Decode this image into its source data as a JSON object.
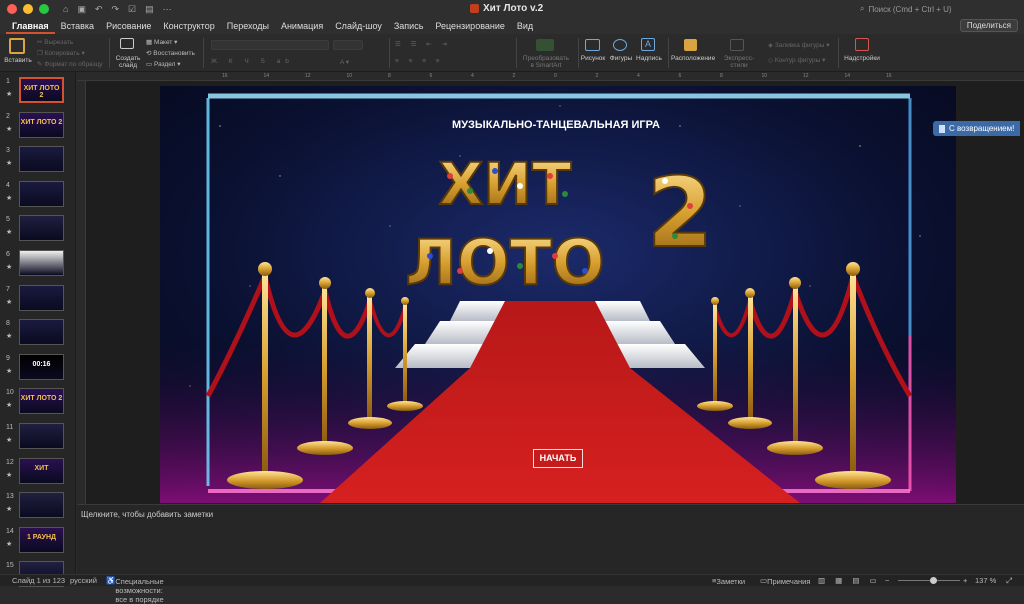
{
  "window": {
    "title": "Хит Лото v.2",
    "search_placeholder": "Поиск (Cmd + Ctrl + U)"
  },
  "tabs": [
    "Главная",
    "Вставка",
    "Рисование",
    "Конструктор",
    "Переходы",
    "Анимация",
    "Слайд-шоу",
    "Запись",
    "Рецензирование",
    "Вид"
  ],
  "share_label": "Поделиться",
  "ribbon": {
    "paste": "Вставить",
    "cut": "Вырезать",
    "copy": "Копировать",
    "format_painter": "Формат по образцу",
    "new_slide": "Создать слайд",
    "layout": "Макет",
    "reset": "Восстановить",
    "section": "Раздел",
    "smartart": "Преобразовать в SmartArt",
    "picture": "Рисунок",
    "shapes": "Фигуры",
    "textbox": "Надпись",
    "arrange": "Расположение",
    "quick_styles": "Экспресс-стили",
    "shape_fill": "Заливка фигуры",
    "shape_outline": "Контур фигуры",
    "addins": "Надстройки"
  },
  "ruler_ticks": [
    "16",
    "14",
    "12",
    "10",
    "8",
    "6",
    "4",
    "2",
    "0",
    "2",
    "4",
    "6",
    "8",
    "10",
    "12",
    "14",
    "16"
  ],
  "slides": [
    {
      "num": "1",
      "label": "ХИТ ЛОТО 2"
    },
    {
      "num": "2",
      "label": "ХИТ ЛОТО 2"
    },
    {
      "num": "3",
      "label": ""
    },
    {
      "num": "4",
      "label": ""
    },
    {
      "num": "5",
      "label": ""
    },
    {
      "num": "6",
      "label": ""
    },
    {
      "num": "7",
      "label": ""
    },
    {
      "num": "8",
      "label": ""
    },
    {
      "num": "9",
      "label": "00:16"
    },
    {
      "num": "10",
      "label": "ХИТ ЛОТО 2"
    },
    {
      "num": "11",
      "label": ""
    },
    {
      "num": "12",
      "label": "ХИТ"
    },
    {
      "num": "13",
      "label": ""
    },
    {
      "num": "14",
      "label": "1 РАУНД"
    },
    {
      "num": "15",
      "label": ""
    }
  ],
  "slide": {
    "subtitle": "МУЗЫКАЛЬНО-ТАНЦЕВАЛЬНАЯ ИГРА",
    "title_line1": "ХИТ",
    "title_line2": "ЛОТО",
    "title_number": "2",
    "start_button": "НАЧАТЬ"
  },
  "welcome_back": "С возвращением!",
  "notes_placeholder": "Щелкните, чтобы добавить заметки",
  "status": {
    "slide_info": "Слайд 1 из 123",
    "language": "русский",
    "accessibility": "Специальные возможности: все в порядке",
    "notes": "Заметки",
    "comments": "Примечания",
    "zoom": "137 %"
  }
}
